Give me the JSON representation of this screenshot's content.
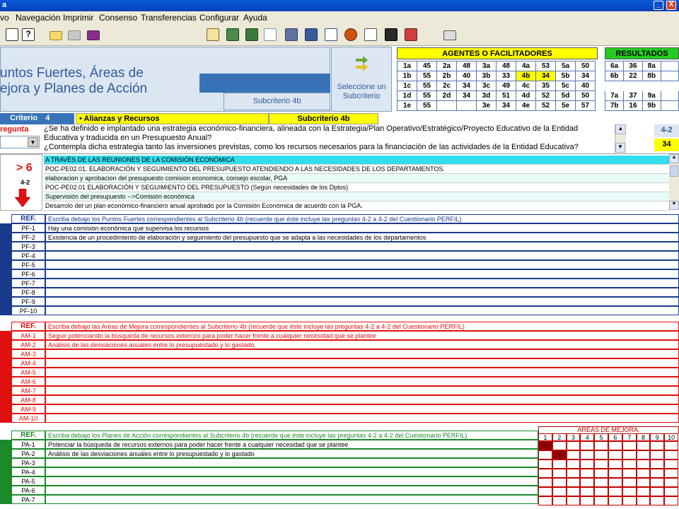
{
  "window": {
    "title": "a",
    "min": "_",
    "close": "X"
  },
  "menu": [
    "vo",
    "Navegación",
    "Imprimir",
    "Consenso",
    "Transferencias",
    "Configurar",
    "Ayuda"
  ],
  "header": {
    "title": "untos Fuertes, Áreas de\nejora y Planes de Acción",
    "subcriterio": "Subcriterio 4b",
    "select": "Seleccione un\nSubcriterio"
  },
  "agentes": {
    "title": "AGENTES O FACILITADORES",
    "rows": [
      [
        "1a",
        "45",
        "2a",
        "48",
        "3a",
        "48",
        "4a",
        "53",
        "5a",
        "50"
      ],
      [
        "1b",
        "55",
        "2b",
        "40",
        "3b",
        "33",
        "4b",
        "34",
        "5b",
        "34"
      ],
      [
        "1c",
        "55",
        "2c",
        "34",
        "3c",
        "49",
        "4c",
        "35",
        "5c",
        "40"
      ],
      [
        "1d",
        "55",
        "2d",
        "34",
        "3d",
        "51",
        "4d",
        "52",
        "5d",
        "50"
      ],
      [
        "1e",
        "55",
        "",
        "",
        "3e",
        "34",
        "4e",
        "52",
        "5e",
        "57"
      ]
    ]
  },
  "resultados": {
    "title": "RESULTADOS",
    "rows": [
      [
        "6a",
        "36",
        "8a",
        ""
      ],
      [
        "6b",
        "22",
        "8b",
        ""
      ],
      [
        "",
        "",
        "",
        ""
      ],
      [
        "7a",
        "37",
        "9a",
        ""
      ],
      [
        "7b",
        "16",
        "9b",
        ""
      ]
    ]
  },
  "criterio": {
    "label": "Criterio",
    "num": "4",
    "name": "• Alianzas y Recursos",
    "sub": "Subcriterio 4b"
  },
  "pregunta": {
    "label": "regunta",
    "text": "¿Se ha definido e implantado una estrategia económico-financiera, alineada con la Estrategia/Plan Operativo/Estratégico/Proyecto Educativo de la Entidad Educativa y traducida en un Presupuesto Anual?\n¿Contempla dicha estrategia tanto las inversiones previstas, como los recursos necesarios para la financiación de las actividades de la Entidad Educativa?",
    "code": "4-2",
    "score": "34"
  },
  "evidencias": {
    "gt": "> 6",
    "code": "4-2",
    "rows": [
      "A TRAVÉS DE LAS REUNIONES DE LA COMISIÓN ECONÓMICA",
      "POC-PE02.01. ELABORACIÓN Y SEGUIMIENTO DEL PRESUPUESTO ATENDIENDO A LAS NECESIDADES DE LOS DEPARTAMENTOS.",
      "elaboracion y aprobacion del presupuesto comision economica, consejo escolar, PGA",
      "POC-PE02.01 ELABORACIÓN Y SEGUIMIENTO DEL PRESUPUESTO (Según necesidades de los Dptos)",
      "Supervisión del presupuesto -->Comisión económica",
      "Desarrolo del un plan económico-financiero anual aprobado por la Comisión Económica de acuerdo con la PGA."
    ]
  },
  "pf": {
    "ref": "REF.",
    "header": "Escriba debajo los Puntos Fuertes correspondientes al Subcriterio 4b (recuerde que éste incluye las preguntas 4-2 a 4-2 del Cuestionario PERFIL)",
    "rows": [
      {
        "ref": "PF-1",
        "text": "Hay una comisión económica que supervisa los recursos"
      },
      {
        "ref": "PF-2",
        "text": "Existencia de un procedimiento de elaboración y seguimiento del presupuesto que se adapta a las necesidades de los departamentos"
      },
      {
        "ref": "PF-3",
        "text": ""
      },
      {
        "ref": "PF-4",
        "text": ""
      },
      {
        "ref": "PF-5",
        "text": ""
      },
      {
        "ref": "PF-6",
        "text": ""
      },
      {
        "ref": "PF-7",
        "text": ""
      },
      {
        "ref": "PF-8",
        "text": ""
      },
      {
        "ref": "PF-9",
        "text": ""
      },
      {
        "ref": "PF-10",
        "text": ""
      }
    ]
  },
  "am": {
    "ref": "REF.",
    "header": "Escriba debajo las Areas de Mejora correspondientes al Subcriterio 4b (recuerde que éste incluye las preguntas 4-2 a 4-2 del Cuestionario PERFIL)",
    "rows": [
      {
        "ref": "AM-1",
        "text": "Seguir potenciando la búsqueda de recursos externos para poder hacer frente a cualquier necesidad que se plantee"
      },
      {
        "ref": "AM-2",
        "text": "Análisis de las desviaciones anuales entre lo presupuestado y lo gastado"
      },
      {
        "ref": "AM-3",
        "text": ""
      },
      {
        "ref": "AM-4",
        "text": ""
      },
      {
        "ref": "AM-5",
        "text": ""
      },
      {
        "ref": "AM-6",
        "text": ""
      },
      {
        "ref": "AM-7",
        "text": ""
      },
      {
        "ref": "AM-8",
        "text": ""
      },
      {
        "ref": "AM-9",
        "text": ""
      },
      {
        "ref": "AM-10",
        "text": ""
      }
    ]
  },
  "pa": {
    "ref": "REF.",
    "header": "Escriba debajo los Planes de Acción correspondientes al Subcriterio 4b (recuerde que éste incluye las preguntas 4-2 a 4-2 del Cuestionario PERFIL)",
    "areas_title": "AREAS DE MEJORA.",
    "areas_nums": [
      "1",
      "2",
      "3",
      "4",
      "5",
      "6",
      "7",
      "8",
      "9",
      "10"
    ],
    "rows": [
      {
        "ref": "PA-1",
        "text": "Potenciar la búsqueda de recursos externos para poder hacer frente a cualquier necesidad que se plantee",
        "mark": 1
      },
      {
        "ref": "PA-2",
        "text": "Análisis de las desviaciones anuales entre lo presupuestado y lo gastado",
        "mark": 2
      },
      {
        "ref": "PA-3",
        "text": "",
        "mark": 0
      },
      {
        "ref": "PA-4",
        "text": "",
        "mark": 0
      },
      {
        "ref": "PA-5",
        "text": "",
        "mark": 0
      },
      {
        "ref": "PA-6",
        "text": "",
        "mark": 0
      },
      {
        "ref": "PA-7",
        "text": "",
        "mark": 0
      }
    ]
  },
  "colors": {
    "blue": "#1a3a8c",
    "red": "#e01010",
    "green": "#1a8a2a",
    "yellow": "#ffff00"
  }
}
